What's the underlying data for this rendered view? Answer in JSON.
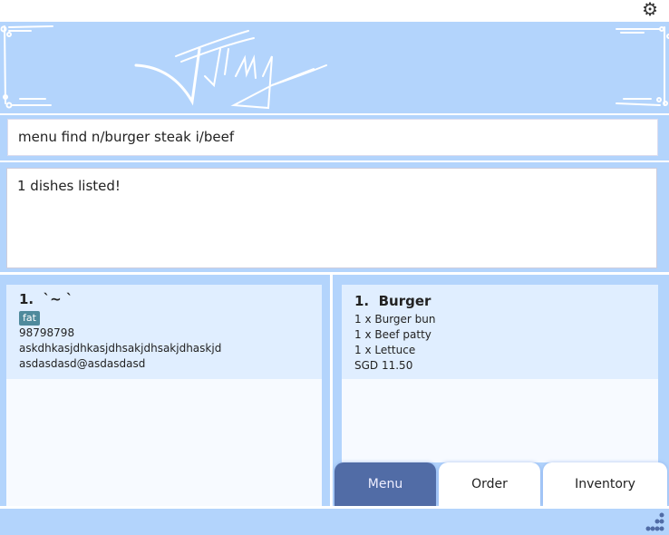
{
  "window": {
    "settings_icon": "gear-icon"
  },
  "banner": {
    "logo_text": "Jimy"
  },
  "command": {
    "value": "menu find n/burger steak i/beef"
  },
  "result": {
    "text": "1 dishes listed!"
  },
  "left_list": {
    "items": [
      {
        "index": "1.",
        "name": "`~ `",
        "tags": [
          "fat"
        ],
        "phone": "98798798",
        "address": "askdhkasjdhkasjdhsakjdhsakjdhaskjd",
        "email": "asdasdasd@asdasdasd"
      }
    ]
  },
  "right_list": {
    "items": [
      {
        "index": "1.",
        "name": "Burger",
        "ingredients": [
          "1 x Burger bun",
          "1 x Beef patty",
          "1 x Lettuce"
        ],
        "price": "SGD 11.50"
      }
    ]
  },
  "tabs": [
    {
      "label": "Menu",
      "active": true
    },
    {
      "label": "Order",
      "active": false
    },
    {
      "label": "Inventory",
      "active": false
    }
  ],
  "colors": {
    "background": "#b3d4fc",
    "active_tab": "#516ca6",
    "card": "#e0eeff",
    "tag": "#4f8a9c"
  }
}
